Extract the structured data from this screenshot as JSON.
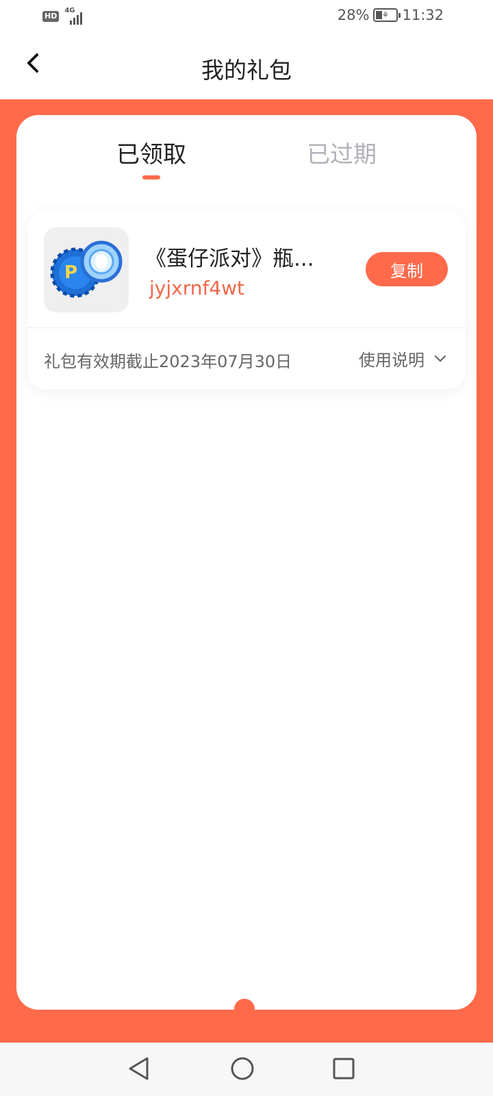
{
  "status_bar": {
    "hd_label": "HD",
    "network_label": "4G",
    "battery_percent": "28%",
    "battery_level": 0.28,
    "time": "11:32"
  },
  "header": {
    "title": "我的礼包",
    "back_icon": "chevron-left-icon"
  },
  "tabs": [
    {
      "label": "已领取",
      "active": true
    },
    {
      "label": "已过期",
      "active": false
    }
  ],
  "gift": {
    "name": "《蛋仔派对》瓶...",
    "code": "jyjxrnf4wt",
    "copy_label": "复制",
    "expiry": "礼包有效期截止2023年07月30日",
    "usage_label": "使用说明"
  },
  "colors": {
    "accent": "#ff6a4b",
    "code_text": "#f0684a",
    "inactive_tab": "#b0b0b8"
  },
  "nav": [
    "back-triangle-icon",
    "home-circle-icon",
    "recents-square-icon"
  ]
}
